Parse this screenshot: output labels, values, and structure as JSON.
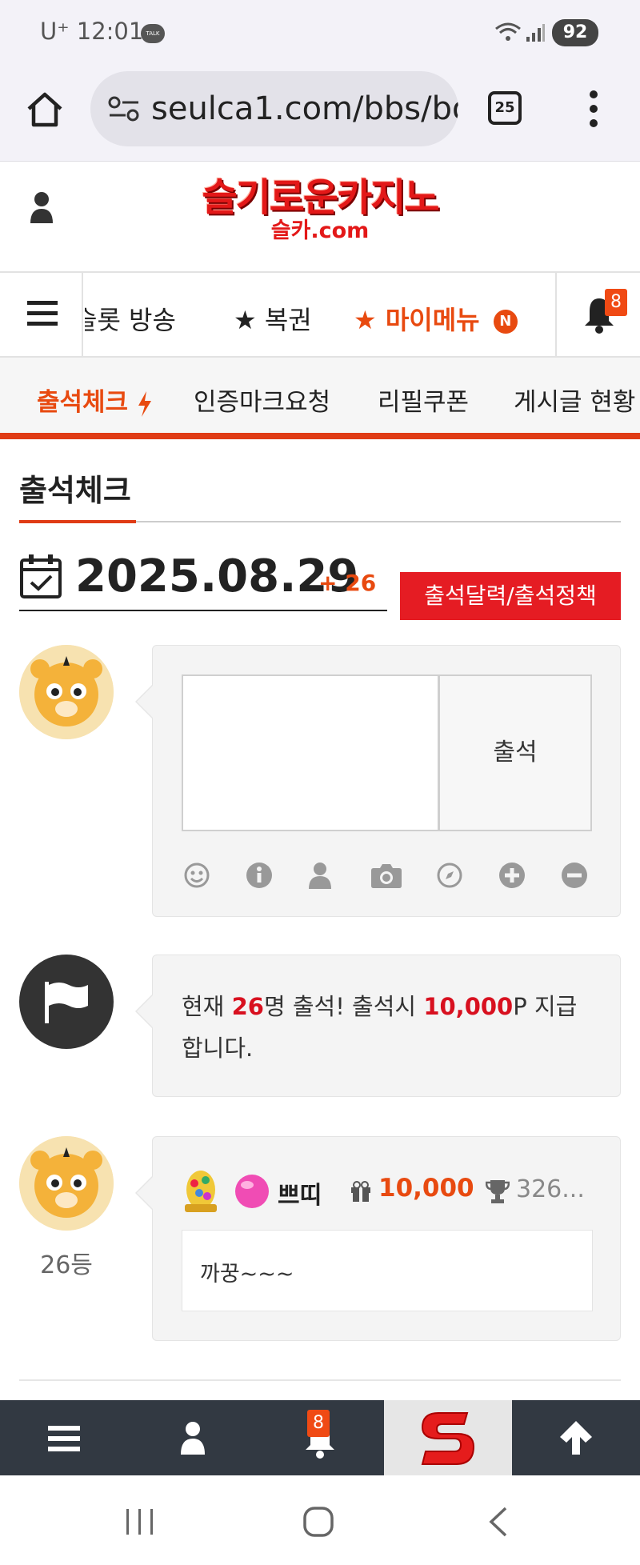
{
  "statusbar": {
    "carrier": "U⁺ 12:01",
    "talk_badge": "TALK",
    "battery": "92"
  },
  "browser": {
    "url": "seulca1.com/bbs/bo",
    "tab_count": "25"
  },
  "header": {
    "logo_main": "슬기로운카지노",
    "logo_sub": "슬카.com"
  },
  "mainnav": {
    "items": [
      "슬롯 방송",
      "★ 복권",
      "★ 마이메뉴"
    ],
    "new_badge": "N",
    "bell_count": "8"
  },
  "subnav": {
    "items": [
      "출석체크",
      "인증마크요청",
      "리필쿠폰",
      "게시글 현황"
    ]
  },
  "page": {
    "title": "출석체크",
    "date": "2025.08.29",
    "date_count": "+ 26",
    "calendar_button": "출석달력/출석정책"
  },
  "compose": {
    "submit_label": "출석"
  },
  "notice": {
    "prefix": "현재 ",
    "count": "26",
    "mid": "명 출석! 출석시 ",
    "points": "10,000",
    "suffix": "P 지급 합니다."
  },
  "entry": {
    "rank": "26등",
    "username": "쁘띠",
    "reward": "10,000",
    "trophy": "326...",
    "message": "까꿍~~~"
  },
  "bottombar": {
    "bell_count": "8"
  },
  "colors": {
    "accent": "#e84a10",
    "red": "#d8101f",
    "dark": "#323942"
  }
}
